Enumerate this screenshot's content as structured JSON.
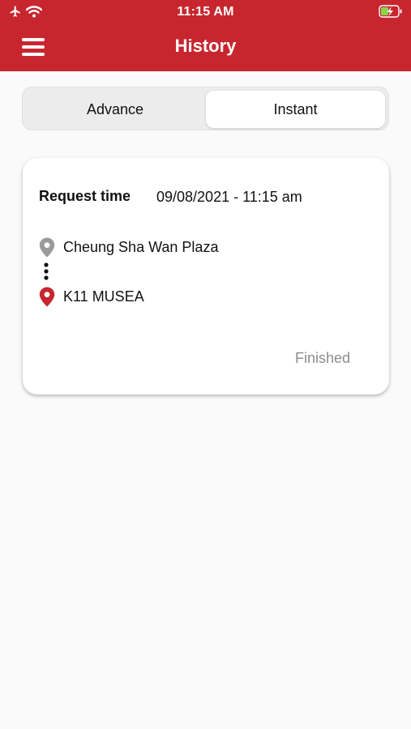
{
  "status_bar": {
    "time": "11:15 AM",
    "icons": [
      "airplane-icon",
      "wifi-icon",
      "battery-charging-icon"
    ]
  },
  "header": {
    "title": "History",
    "menu_icon": "hamburger-menu-icon"
  },
  "tabs": [
    {
      "label": "Advance",
      "selected": false
    },
    {
      "label": "Instant",
      "selected": true
    }
  ],
  "history": [
    {
      "request_label": "Request time",
      "request_time": "09/08/2021 - 11:15 am",
      "from": "Cheung Sha Wan Plaza",
      "to": "K11 MUSEA",
      "status": "Finished"
    }
  ],
  "colors": {
    "brand": "#c8262f",
    "pin_from": "#9a9a9a",
    "pin_to": "#c8262f",
    "status_text": "#8c8c8c"
  }
}
